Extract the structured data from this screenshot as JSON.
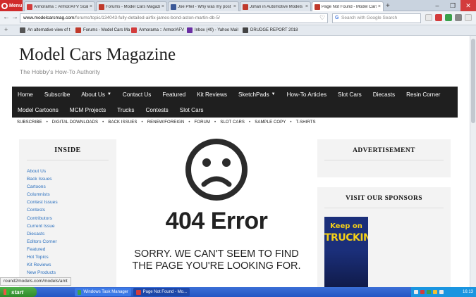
{
  "browser": {
    "menu_label": "Menu",
    "tabs": [
      {
        "title": "Armorama :: Armor/AFV Scal",
        "favicon_color": "#d33c3c",
        "active": false
      },
      {
        "title": "Forums - Model Cars Magazin",
        "favicon_color": "#c0392b",
        "active": false
      },
      {
        "title": "Joe Pfeil - Why was my post r",
        "favicon_color": "#3b5998",
        "active": false
      },
      {
        "title": "Johan in Automotive Models",
        "favicon_color": "#c0392b",
        "active": false
      },
      {
        "title": "Page Not Found - Model Cars",
        "favicon_color": "#c0392b",
        "active": true
      }
    ],
    "newtab_label": "+",
    "url_host": "www.modelcarsmag.com",
    "url_path": "/forums/topic/134043-fully-detailed-airfix-james-bond-aston-martin-db-5/",
    "search_placeholder": "Search with Google Search",
    "bookmarks": [
      {
        "label": "An alternative view of t",
        "favicon_color": "#555555"
      },
      {
        "label": "Forums - Model Cars Ma",
        "favicon_color": "#c0392b"
      },
      {
        "label": "Armorama :: Armor/AFV",
        "favicon_color": "#d33c3c"
      },
      {
        "label": "Inbox (40) - Yahoo Mail",
        "favicon_color": "#6b2fa3"
      },
      {
        "label": "DRUDGE REPORT 2018",
        "favicon_color": "#444444"
      }
    ],
    "status_link": "round2models.com/models/amt"
  },
  "site": {
    "title": "Model Cars Magazine",
    "tagline": "The Hobby's How-To Authority",
    "nav_row1": [
      {
        "label": "Home",
        "dropdown": false
      },
      {
        "label": "Subscribe",
        "dropdown": false
      },
      {
        "label": "About Us",
        "dropdown": true
      },
      {
        "label": "Contact Us",
        "dropdown": false
      },
      {
        "label": "Featured",
        "dropdown": false
      },
      {
        "label": "Kit Reviews",
        "dropdown": false
      },
      {
        "label": "SketchPads",
        "dropdown": true
      },
      {
        "label": "How-To Articles",
        "dropdown": false
      },
      {
        "label": "Slot Cars",
        "dropdown": false
      },
      {
        "label": "Diecasts",
        "dropdown": false
      },
      {
        "label": "Resin Corner",
        "dropdown": false
      }
    ],
    "nav_row2": [
      {
        "label": "Model Cartoons",
        "dropdown": false
      },
      {
        "label": "MCM Projects",
        "dropdown": false
      },
      {
        "label": "Trucks",
        "dropdown": false
      },
      {
        "label": "Contests",
        "dropdown": false
      },
      {
        "label": "Slot Cars",
        "dropdown": false
      }
    ],
    "subnav": [
      "SUBSCRIBE",
      "DIGITAL DOWNLOADS",
      "BACK ISSUES",
      "RENEW/FOREIGN",
      "FORUM",
      "SLOT CARS",
      "SAMPLE COPY",
      "T-SHIRTS"
    ],
    "inside": {
      "heading": "INSIDE",
      "links": [
        "About Us",
        "Back Issues",
        "Cartoons",
        "Columnists",
        "Contest Issues",
        "Contests",
        "Contributors",
        "Current Issue",
        "Diecasts",
        "Editors Corner",
        "Featured",
        "Hot Topics",
        "Kit Reviews",
        "New Products"
      ]
    },
    "error": {
      "title": "404 Error",
      "line1": "SORRY. WE CAN'T SEEM TO FIND",
      "line2": "THE PAGE YOU'RE LOOKING FOR."
    },
    "advertisement_heading": "ADVERTISEMENT",
    "sponsors_heading": "VISIT OUR SPONSORS",
    "sponsor_ad": {
      "line1": "Keep on",
      "line2": "TRUCKIN'"
    }
  },
  "taskbar": {
    "start_label": "start",
    "tasks": [
      {
        "label": "Windows Task Manager",
        "favicon_color": "#3aa04a"
      },
      {
        "label": "Page Not Found - Mo...",
        "favicon_color": "#d33c3c"
      }
    ],
    "clock": "16:13"
  },
  "colors": {
    "nav_bg": "#1f1f1f",
    "link": "#2a6fbe",
    "panel_bg": "#f3f3f3"
  }
}
